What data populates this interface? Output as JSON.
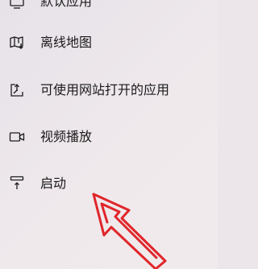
{
  "menu": {
    "items": [
      {
        "label": "默认应用",
        "icon": "default-apps-icon"
      },
      {
        "label": "离线地图",
        "icon": "offline-map-icon"
      },
      {
        "label": "可使用网站打开的应用",
        "icon": "apps-for-websites-icon"
      },
      {
        "label": "视频播放",
        "icon": "video-camera-icon"
      },
      {
        "label": "启动",
        "icon": "startup-icon"
      }
    ]
  },
  "annotation": {
    "arrow_color": "#e0262a"
  }
}
